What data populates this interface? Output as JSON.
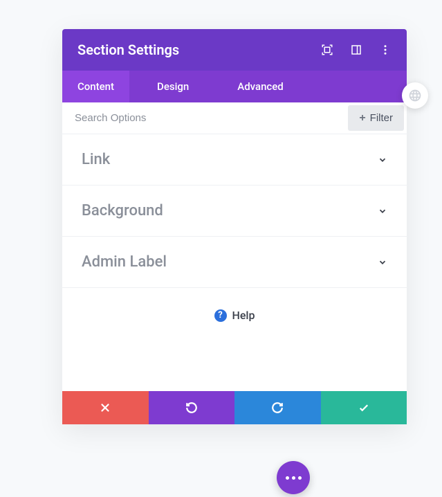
{
  "header": {
    "title": "Section Settings"
  },
  "tabs": [
    {
      "label": "Content",
      "active": true
    },
    {
      "label": "Design",
      "active": false
    },
    {
      "label": "Advanced",
      "active": false
    }
  ],
  "search": {
    "placeholder": "Search Options",
    "filter_label": "Filter"
  },
  "accordions": [
    {
      "label": "Link"
    },
    {
      "label": "Background"
    },
    {
      "label": "Admin Label"
    }
  ],
  "help": {
    "label": "Help"
  }
}
